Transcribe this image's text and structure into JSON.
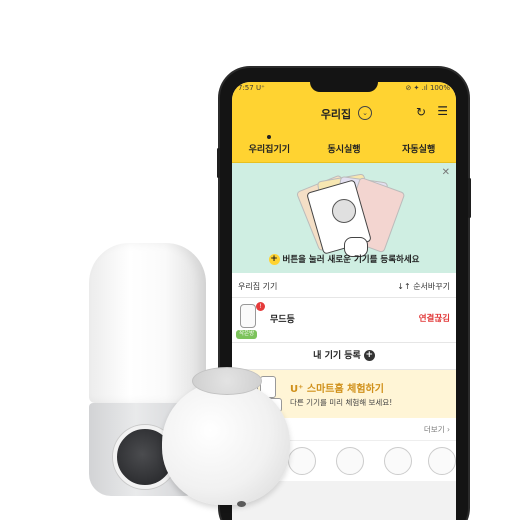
{
  "statusbar": {
    "time": "7:57",
    "carrier": "U⁺",
    "right": "⊘ ✦ .ıl 100%"
  },
  "header": {
    "title": "우리집",
    "chevron": "⌄",
    "refresh": "↻",
    "menu": "☰"
  },
  "tabs": [
    {
      "label": "우리집기기",
      "active": true
    },
    {
      "label": "동시실행",
      "active": false
    },
    {
      "label": "자동실행",
      "active": false
    }
  ],
  "banner": {
    "close": "✕",
    "hint_icon": "+",
    "hint": "버튼을 눌러 새로운 기기를 등록하세요"
  },
  "list_header": {
    "left": "우리집 기기",
    "right": "↓↑ 순서바꾸기"
  },
  "devices": [
    {
      "name": "무드등",
      "status": "연결끊김",
      "badge": "!",
      "tag": "작은방"
    }
  ],
  "register": {
    "label": "내 기기 등록",
    "icon": "+"
  },
  "promo": {
    "title": "U⁺ 스마트홈 체험하기",
    "subtitle": "다른 기기를 미리 체험해 보세요!"
  },
  "more": {
    "label": "더보기 ›"
  },
  "colors": {
    "brand_yellow": "#ffd331",
    "banner_mint": "#cfeee2",
    "status_red": "#e23a3a",
    "promo_bg": "#fff5d6"
  }
}
